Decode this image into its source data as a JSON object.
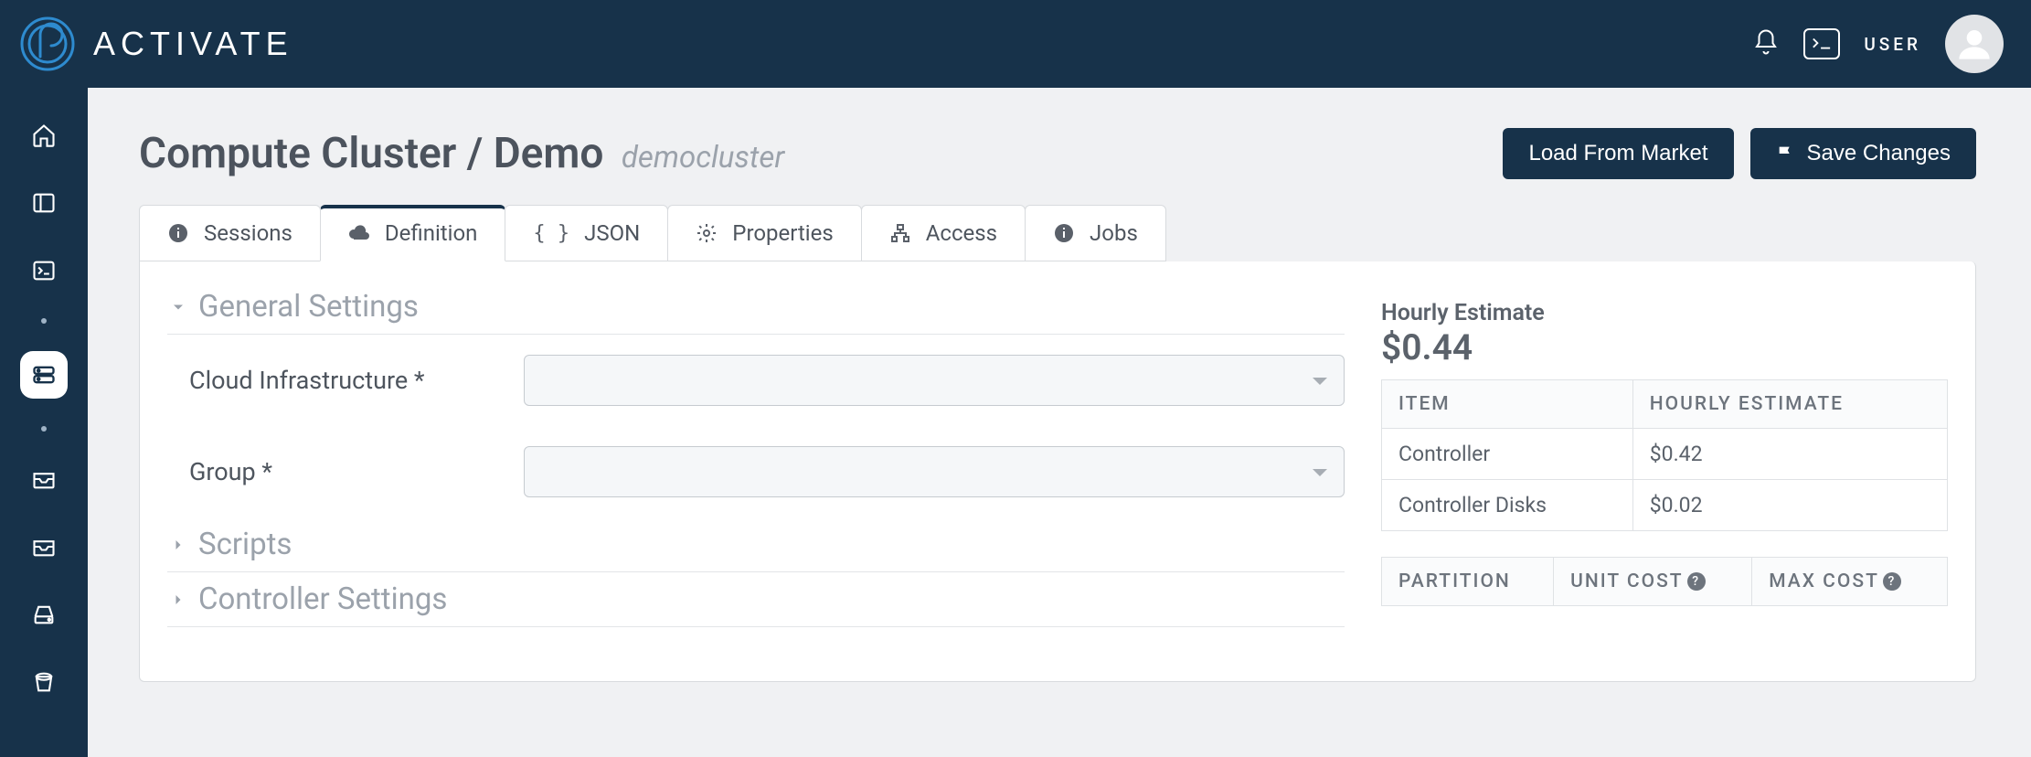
{
  "header": {
    "brand": "ACTIVATE",
    "user_label": "USER"
  },
  "page": {
    "title_prefix": "Compute Cluster / Demo",
    "title_secondary": "democluster",
    "actions": {
      "load_market": "Load From Market",
      "save_changes": "Save Changes"
    }
  },
  "tabs": {
    "sessions": "Sessions",
    "definition": "Definition",
    "json": "JSON",
    "properties": "Properties",
    "access": "Access",
    "jobs": "Jobs"
  },
  "sections": {
    "general": "General Settings",
    "scripts": "Scripts",
    "controller": "Controller Settings"
  },
  "form": {
    "cloud_infra_label": "Cloud Infrastructure *",
    "group_label": "Group *"
  },
  "estimate": {
    "title": "Hourly Estimate",
    "value": "$0.44",
    "columns": {
      "item": "ITEM",
      "hourly": "HOURLY ESTIMATE"
    },
    "rows": [
      {
        "item": "Controller",
        "hourly": "$0.42"
      },
      {
        "item": "Controller Disks",
        "hourly": "$0.02"
      }
    ],
    "partition_columns": {
      "partition": "PARTITION",
      "unit_cost": "UNIT COST",
      "max_cost": "MAX COST"
    }
  }
}
